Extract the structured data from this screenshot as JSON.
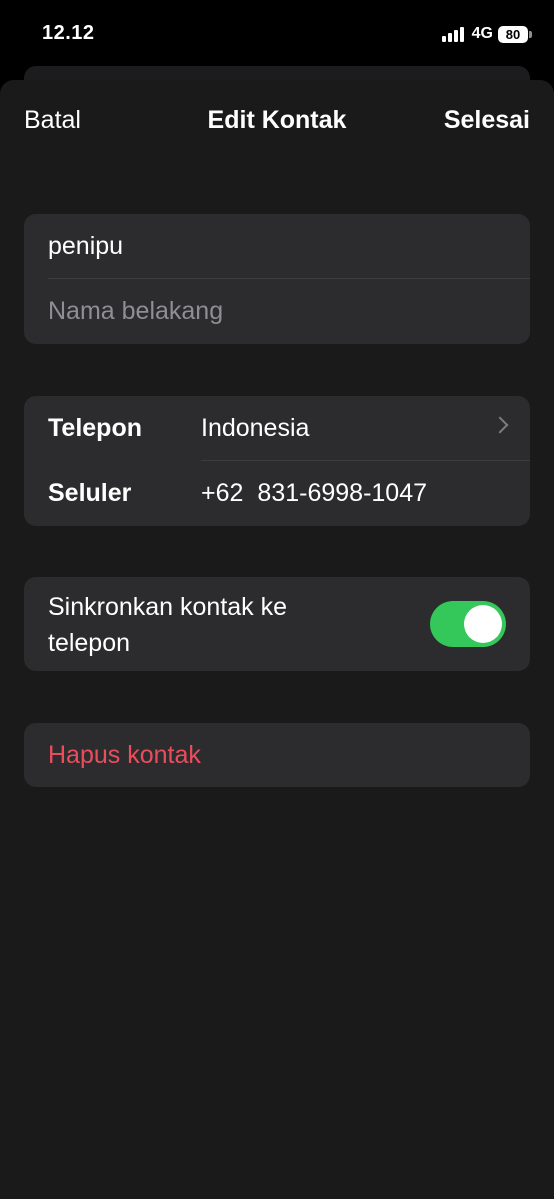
{
  "status_bar": {
    "time": "12.12",
    "network": "4G",
    "battery": "80"
  },
  "nav": {
    "cancel_label": "Batal",
    "title": "Edit Kontak",
    "done_label": "Selesai"
  },
  "name": {
    "first_name": "penipu",
    "last_name_placeholder": "Nama belakang"
  },
  "phone": {
    "country_label": "Telepon",
    "country_value": "Indonesia",
    "number_label": "Seluler",
    "country_code": "+62",
    "number": "831-6998-1047"
  },
  "sync": {
    "label": "Sinkronkan kontak ke telepon",
    "enabled": true
  },
  "delete": {
    "label": "Hapus kontak"
  },
  "colors": {
    "accent_green": "#34c759",
    "destructive_red": "#eb4d5c",
    "card_background": "#2c2c2e",
    "sheet_background": "#1a1a1a"
  }
}
